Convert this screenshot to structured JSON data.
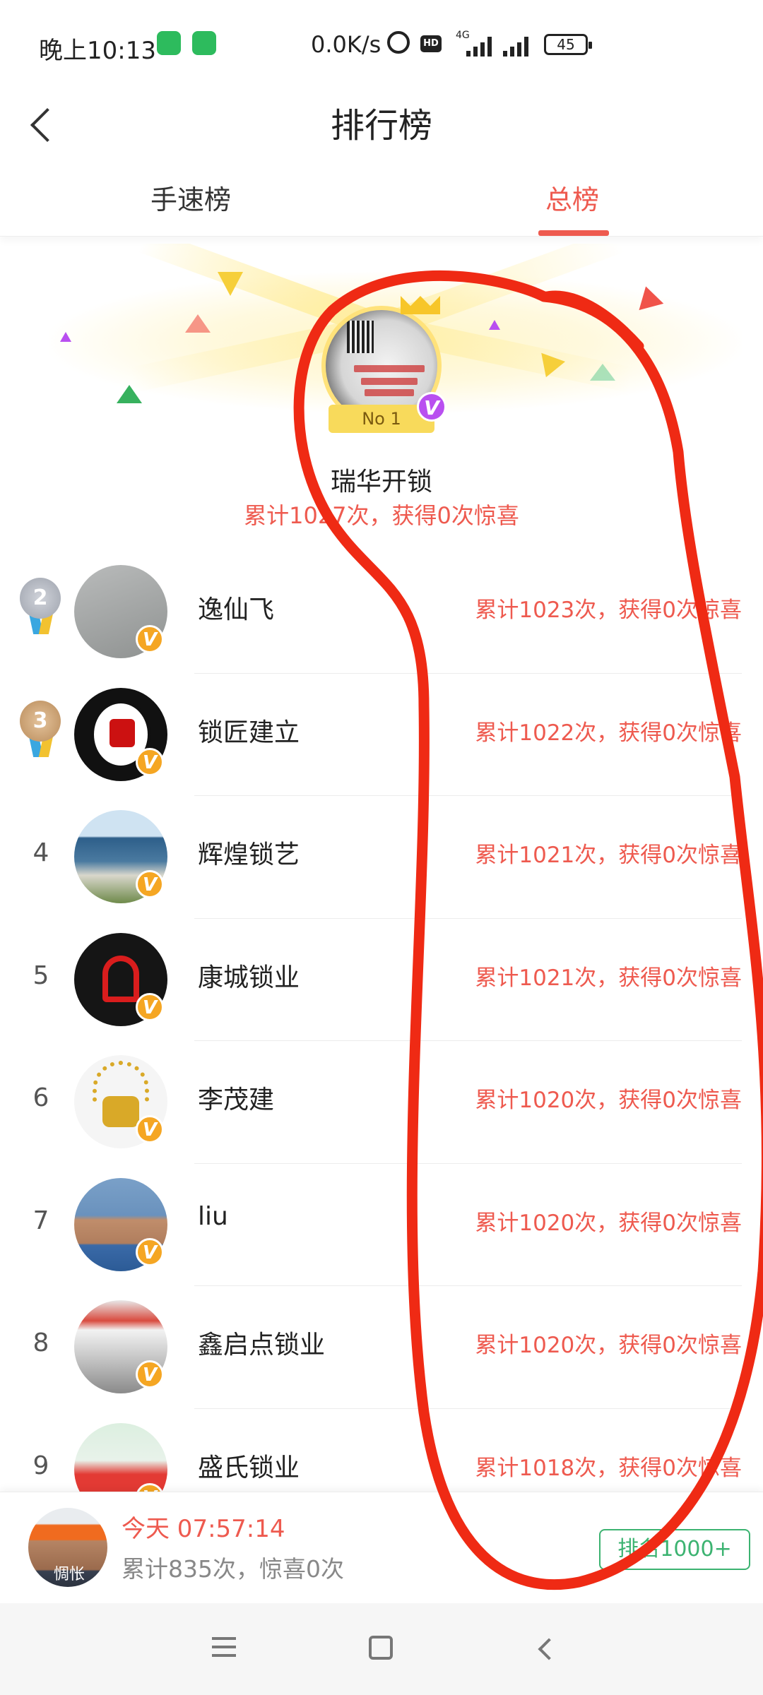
{
  "status_bar": {
    "time": "晚上10:13",
    "net_speed": "0.0K/s",
    "hd": "HD",
    "network": "4G",
    "battery": "45"
  },
  "header": {
    "title": "排行榜"
  },
  "tabs": [
    {
      "label": "手速榜",
      "active": false
    },
    {
      "label": "总榜",
      "active": true
    }
  ],
  "accent_color": "#ee5a4f",
  "top_rank": {
    "badge": "No 1",
    "name": "瑞华开锁",
    "stats": "累计1027次，获得0次惊喜"
  },
  "rankings": [
    {
      "rank": "2",
      "name": "逸仙飞",
      "stats": "累计1023次，获得0次惊喜"
    },
    {
      "rank": "3",
      "name": "锁匠建立",
      "stats": "累计1022次，获得0次惊喜"
    },
    {
      "rank": "4",
      "name": "辉煌锁艺",
      "stats": "累计1021次，获得0次惊喜"
    },
    {
      "rank": "5",
      "name": "康城锁业",
      "stats": "累计1021次，获得0次惊喜"
    },
    {
      "rank": "6",
      "name": "李茂建",
      "stats": "累计1020次，获得0次惊喜"
    },
    {
      "rank": "7",
      "name": "liu",
      "stats": "累计1020次，获得0次惊喜"
    },
    {
      "rank": "8",
      "name": "鑫启点锁业",
      "stats": "累计1020次，获得0次惊喜"
    },
    {
      "rank": "9",
      "name": "盛氏锁业",
      "stats": "累计1018次，获得0次惊喜"
    }
  ],
  "verified_mark": "V",
  "my_rank": {
    "avatar_text": "惆怅",
    "time": "今天 07:57:14",
    "stats": "累计835次，惊喜0次",
    "rank_label": "排名1000+"
  },
  "icons": {
    "back": "back-arrow-icon",
    "nav_menu": "menu-icon",
    "nav_home": "home-icon",
    "nav_back": "nav-back-icon"
  }
}
